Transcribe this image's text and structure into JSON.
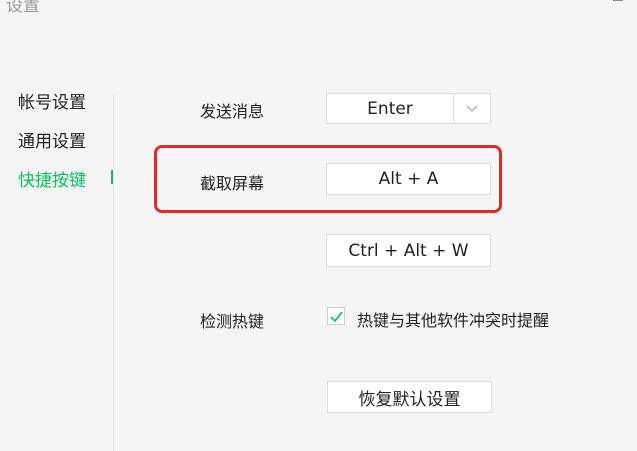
{
  "window": {
    "title": "设置"
  },
  "sidebar": {
    "items": [
      {
        "label": "帐号设置",
        "active": false
      },
      {
        "label": "通用设置",
        "active": false
      },
      {
        "label": "快捷按键",
        "active": true
      }
    ]
  },
  "shortcuts": {
    "send_message": {
      "label": "发送消息",
      "value": "Enter",
      "icon": "chevron-down-icon"
    },
    "screenshot": {
      "label": "截取屏幕",
      "value": "Alt + A",
      "highlight_color": "#e02a2a"
    },
    "unlabeled_shortcut": {
      "value": "Ctrl + Alt + W"
    },
    "detect_hotkeys": {
      "label": "检测热键",
      "checkbox_label": "热键与其他软件冲突时提醒",
      "checked": true
    }
  },
  "reset_button": {
    "label": "恢复默认设置"
  },
  "colors": {
    "accent": "#07c160",
    "highlight": "#e02a2a"
  }
}
